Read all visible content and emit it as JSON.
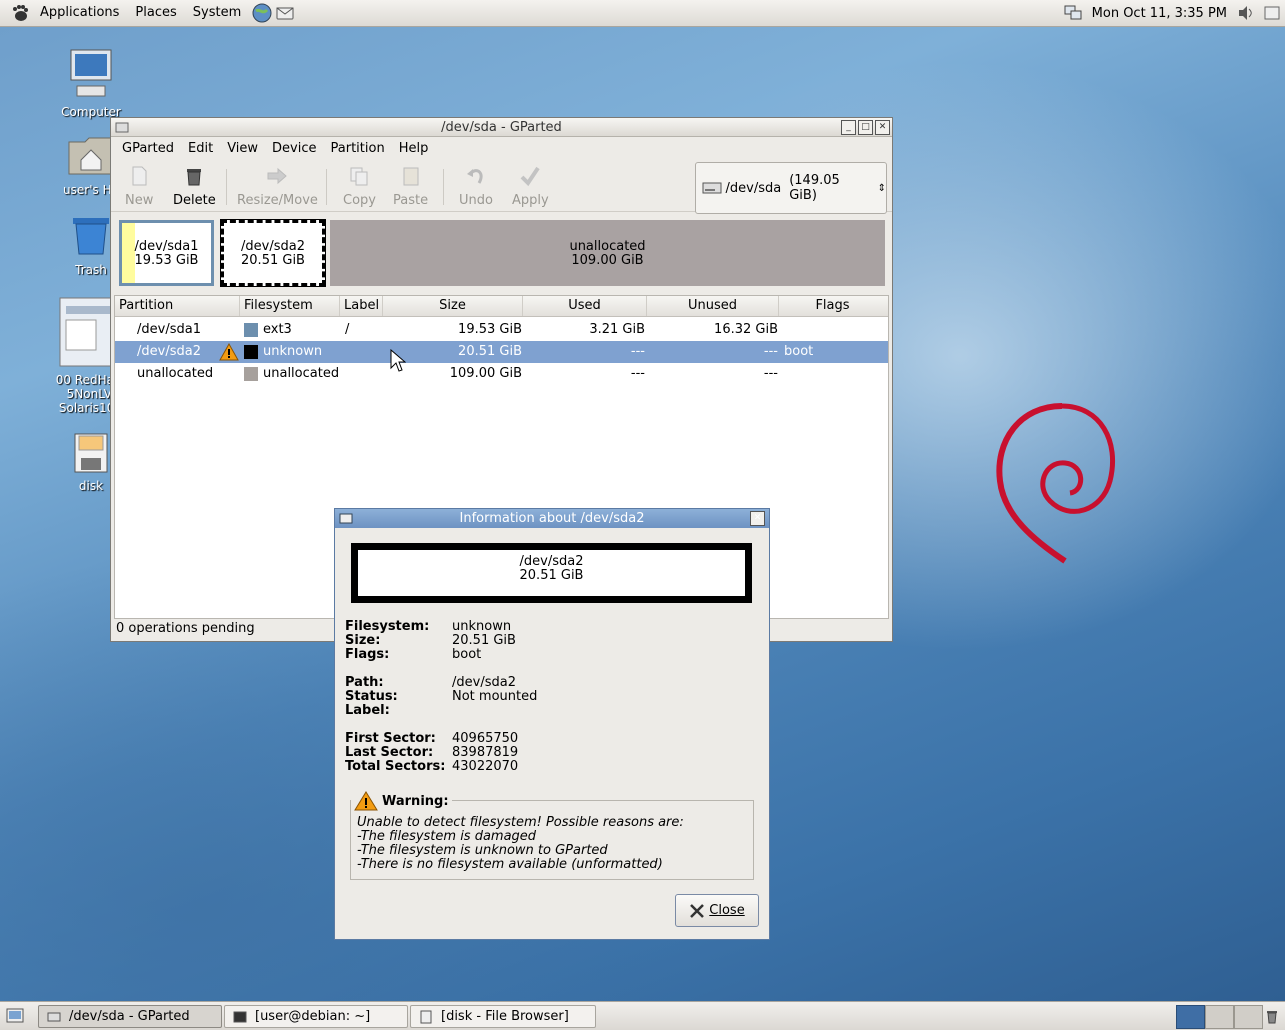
{
  "top_panel": {
    "menus": [
      "Applications",
      "Places",
      "System"
    ],
    "clock": "Mon Oct 11,  3:35 PM"
  },
  "desktop_icons": [
    {
      "label": "Computer"
    },
    {
      "label": "user's Ho"
    },
    {
      "label": "Trash"
    },
    {
      "label": "00 RedHatE\n5NonLVI\nSolaris10U"
    },
    {
      "label": "disk"
    }
  ],
  "gparted": {
    "title": "/dev/sda - GParted",
    "menu": [
      "GParted",
      "Edit",
      "View",
      "Device",
      "Partition",
      "Help"
    ],
    "toolbar": {
      "new": "New",
      "delete": "Delete",
      "resize": "Resize/Move",
      "copy": "Copy",
      "paste": "Paste",
      "undo": "Undo",
      "apply": "Apply"
    },
    "device": {
      "name": "/dev/sda",
      "size": "(149.05 GiB)"
    },
    "diskmap": [
      {
        "name": "/dev/sda1",
        "size": "19.53 GiB"
      },
      {
        "name": "/dev/sda2",
        "size": "20.51 GiB"
      },
      {
        "name": "unallocated",
        "size": "109.00 GiB"
      }
    ],
    "columns": [
      "Partition",
      "Filesystem",
      "Label",
      "Size",
      "Used",
      "Unused",
      "Flags"
    ],
    "rows": [
      {
        "partition": "/dev/sda1",
        "fs": "ext3",
        "fs_color": "#6d8fae",
        "label": "/",
        "size": "19.53 GiB",
        "used": "3.21 GiB",
        "unused": "16.32 GiB",
        "flags": ""
      },
      {
        "partition": "/dev/sda2",
        "fs": "unknown",
        "fs_color": "#000000",
        "label": "",
        "size": "20.51 GiB",
        "used": "---",
        "unused": "---",
        "flags": "boot"
      },
      {
        "partition": "unallocated",
        "fs": "unallocated",
        "fs_color": "#a6a09c",
        "label": "",
        "size": "109.00 GiB",
        "used": "---",
        "unused": "---",
        "flags": ""
      }
    ],
    "status": "0 operations pending"
  },
  "dialog": {
    "title": "Information about /dev/sda2",
    "box_name": "/dev/sda2",
    "box_size": "20.51 GiB",
    "filesystem_k": "Filesystem:",
    "filesystem_v": "unknown",
    "size_k": "Size:",
    "size_v": "20.51 GiB",
    "flags_k": "Flags:",
    "flags_v": "boot",
    "path_k": "Path:",
    "path_v": "/dev/sda2",
    "status_k": "Status:",
    "status_v": "Not mounted",
    "label_k": "Label:",
    "first_k": "First Sector:",
    "first_v": "40965750",
    "last_k": "Last Sector:",
    "last_v": "83987819",
    "total_k": "Total Sectors:",
    "total_v": "43022070",
    "warning_title": "Warning:",
    "warning_lines": [
      "Unable to detect filesystem! Possible reasons are:",
      "-The filesystem is damaged",
      "-The filesystem is unknown to GParted",
      "-There is no filesystem available (unformatted)"
    ],
    "close": "Close"
  },
  "taskbar": [
    {
      "label": "/dev/sda - GParted"
    },
    {
      "label": "[user@debian: ~]"
    },
    {
      "label": "[disk - File Browser]"
    }
  ]
}
